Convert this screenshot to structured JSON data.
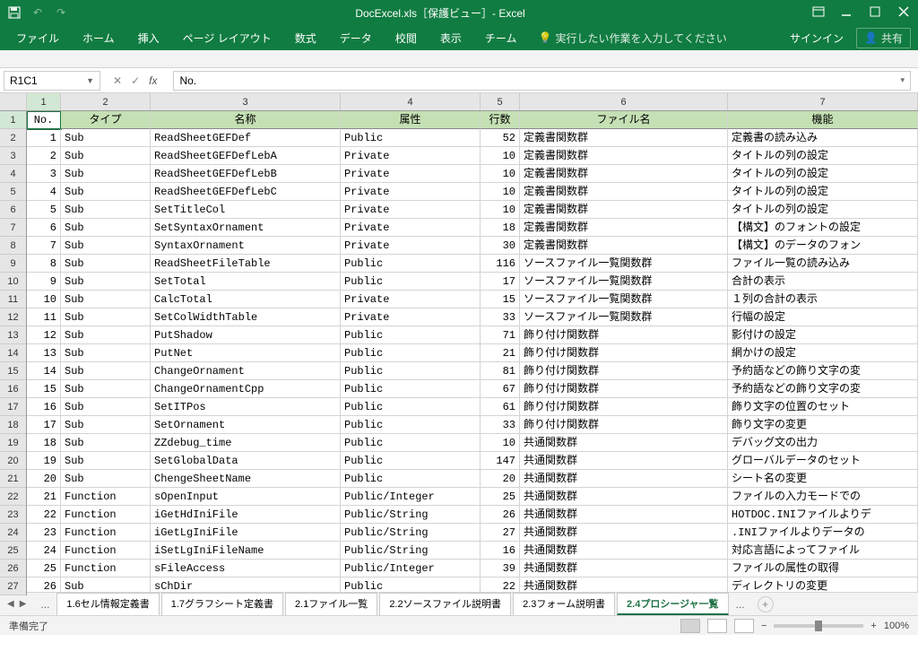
{
  "title": "DocExcel.xls［保護ビュー］- Excel",
  "ribbon": {
    "tabs": [
      "ファイル",
      "ホーム",
      "挿入",
      "ページ レイアウト",
      "数式",
      "データ",
      "校閲",
      "表示",
      "チーム"
    ],
    "tell": "実行したい作業を入力してください",
    "signin": "サインイン",
    "share": "共有"
  },
  "namebox": "R1C1",
  "formula": "No.",
  "col_nums": [
    "1",
    "2",
    "3",
    "4",
    "5",
    "6",
    "7"
  ],
  "headers": [
    "No.",
    "タイプ",
    "名称",
    "属性",
    "行数",
    "ファイル名",
    "機能"
  ],
  "rows": [
    [
      "1",
      "Sub",
      "ReadSheetGEFDef",
      "Public",
      "52",
      "定義書関数群",
      "定義書の読み込み"
    ],
    [
      "2",
      "Sub",
      "ReadSheetGEFDefLebA",
      "Private",
      "10",
      "定義書関数群",
      "タイトルの列の設定"
    ],
    [
      "3",
      "Sub",
      "ReadSheetGEFDefLebB",
      "Private",
      "10",
      "定義書関数群",
      "タイトルの列の設定"
    ],
    [
      "4",
      "Sub",
      "ReadSheetGEFDefLebC",
      "Private",
      "10",
      "定義書関数群",
      "タイトルの列の設定"
    ],
    [
      "5",
      "Sub",
      "SetTitleCol",
      "Private",
      "10",
      "定義書関数群",
      "タイトルの列の設定"
    ],
    [
      "6",
      "Sub",
      "SetSyntaxOrnament",
      "Private",
      "18",
      "定義書関数群",
      "【構文】のフォントの設定"
    ],
    [
      "7",
      "Sub",
      "SyntaxOrnament",
      "Private",
      "30",
      "定義書関数群",
      "【構文】のデータのフォン"
    ],
    [
      "8",
      "Sub",
      "ReadSheetFileTable",
      "Public",
      "116",
      "ソースファイル一覧関数群",
      "ファイル一覧の読み込み"
    ],
    [
      "9",
      "Sub",
      "SetTotal",
      "Public",
      "17",
      "ソースファイル一覧関数群",
      "合計の表示"
    ],
    [
      "10",
      "Sub",
      "CalcTotal",
      "Private",
      "15",
      "ソースファイル一覧関数群",
      "１列の合計の表示"
    ],
    [
      "11",
      "Sub",
      "SetColWidthTable",
      "Private",
      "33",
      "ソースファイル一覧関数群",
      "行幅の設定"
    ],
    [
      "12",
      "Sub",
      "PutShadow",
      "Public",
      "71",
      "飾り付け関数群",
      "影付けの設定"
    ],
    [
      "13",
      "Sub",
      "PutNet",
      "Public",
      "21",
      "飾り付け関数群",
      "網かけの設定"
    ],
    [
      "14",
      "Sub",
      "ChangeOrnament",
      "Public",
      "81",
      "飾り付け関数群",
      "予約語などの飾り文字の変"
    ],
    [
      "15",
      "Sub",
      "ChangeOrnamentCpp",
      "Public",
      "67",
      "飾り付け関数群",
      "予約語などの飾り文字の変"
    ],
    [
      "16",
      "Sub",
      "SetITPos",
      "Public",
      "61",
      "飾り付け関数群",
      "飾り文字の位置のセット"
    ],
    [
      "17",
      "Sub",
      "SetOrnament",
      "Public",
      "33",
      "飾り付け関数群",
      "飾り文字の変更"
    ],
    [
      "18",
      "Sub",
      "ZZdebug_time",
      "Public",
      "10",
      "共通関数群",
      "デバッグ文の出力"
    ],
    [
      "19",
      "Sub",
      "SetGlobalData",
      "Public",
      "147",
      "共通関数群",
      "グローバルデータのセット"
    ],
    [
      "20",
      "Sub",
      "ChengeSheetName",
      "Public",
      "20",
      "共通関数群",
      "シート名の変更"
    ],
    [
      "21",
      "Function",
      "sOpenInput",
      "Public/Integer",
      "25",
      "共通関数群",
      "ファイルの入力モードでの"
    ],
    [
      "22",
      "Function",
      "iGetHdIniFile",
      "Public/String",
      "26",
      "共通関数群",
      "HOTDOC.INIファイルよりデ"
    ],
    [
      "23",
      "Function",
      "iGetLgIniFile",
      "Public/String",
      "27",
      "共通関数群",
      ".INIファイルよりデータの"
    ],
    [
      "24",
      "Function",
      "iSetLgIniFileName",
      "Public/String",
      "16",
      "共通関数群",
      "対応言語によってファイル"
    ],
    [
      "25",
      "Function",
      "sFileAccess",
      "Public/Integer",
      "39",
      "共通関数群",
      "ファイルの属性の取得"
    ],
    [
      "26",
      "Sub",
      "sChDir",
      "Public",
      "22",
      "共通関数群",
      "ディレクトリの変更"
    ]
  ],
  "sheets": [
    "1.6セル情報定義書",
    "1.7グラフシート定義書",
    "2.1ファイル一覧",
    "2.2ソースファイル説明書",
    "2.3フォーム説明書",
    "2.4プロシージャ一覧"
  ],
  "active_sheet": 5,
  "status": "準備完了",
  "zoom": "100%"
}
